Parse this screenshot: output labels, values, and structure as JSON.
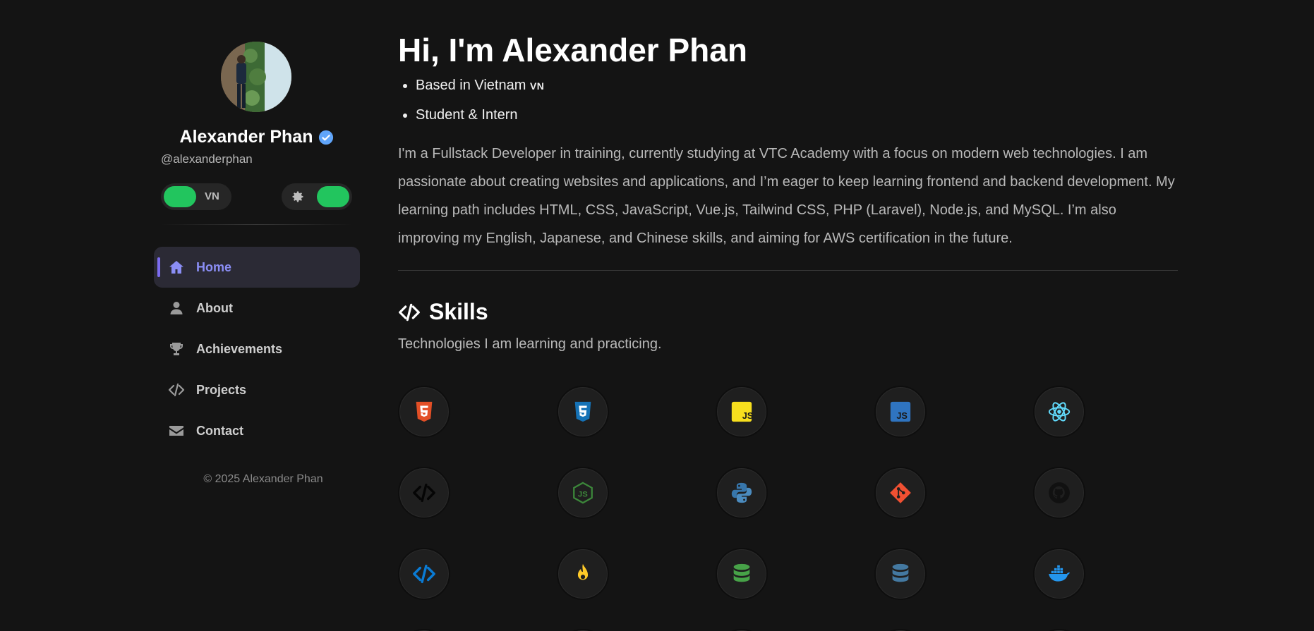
{
  "profile": {
    "name": "Alexander Phan",
    "handle": "@alexanderphan",
    "lang_toggle_label": "VN",
    "verified_color": "#60a5fa"
  },
  "nav": {
    "items": [
      {
        "label": "Home",
        "icon": "home-icon",
        "active": true
      },
      {
        "label": "About",
        "icon": "user-icon",
        "active": false
      },
      {
        "label": "Achievements",
        "icon": "trophy-icon",
        "active": false
      },
      {
        "label": "Projects",
        "icon": "code-icon",
        "active": false
      },
      {
        "label": "Contact",
        "icon": "mail-icon",
        "active": false
      }
    ]
  },
  "footer": {
    "copyright": "© 2025 Alexander Phan"
  },
  "hero": {
    "title": "Hi, I'm Alexander Phan",
    "location": "Based in Vietnam",
    "location_tag": "VN",
    "role": "Student & Intern",
    "intro": "I'm a Fullstack Developer in training, currently studying at VTC Academy with a focus on modern web technologies. I am passionate about creating websites and applications, and I’m eager to keep learning frontend and backend development. My learning path includes HTML, CSS, JavaScript, Vue.js, Tailwind CSS, PHP (Laravel), Node.js, and MySQL. I’m also improving my English, Japanese, and Chinese skills, and aiming for AWS certification in the future."
  },
  "skills": {
    "title": "Skills",
    "subtitle": "Technologies I am learning and practicing.",
    "icons": [
      "html5-icon",
      "css3-icon",
      "javascript-icon",
      "typescript-js-icon",
      "react-icon",
      "nextjs-code-icon",
      "nodejs-icon",
      "python-icon",
      "git-icon",
      "github-icon",
      "vscode-code-icon",
      "firebase-icon",
      "mongodb-database-icon",
      "mysql-database-icon",
      "docker-icon"
    ]
  },
  "colors": {
    "accent": "#8b8ef5",
    "toggle_on": "#22c55e",
    "background": "#141414"
  }
}
